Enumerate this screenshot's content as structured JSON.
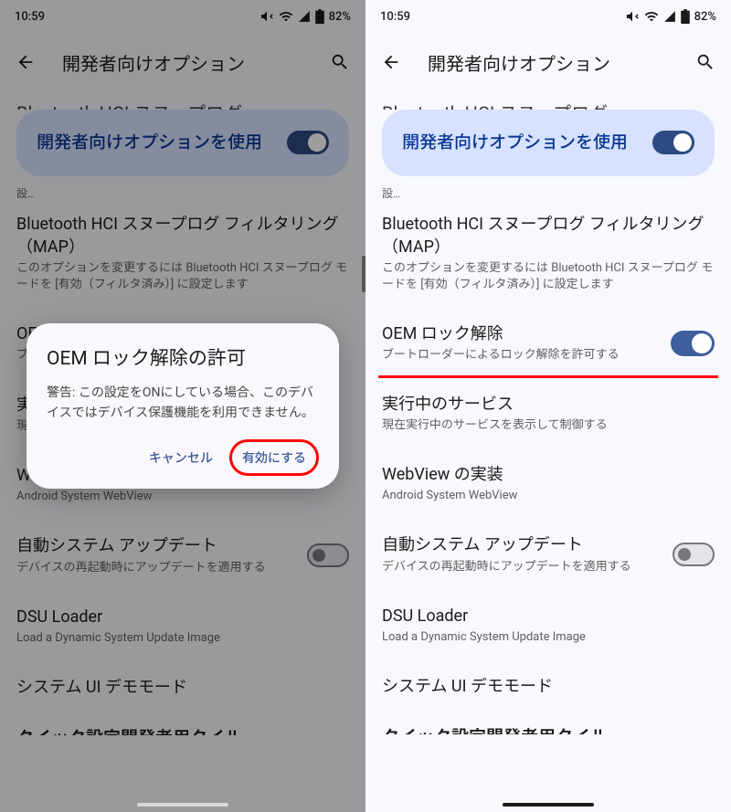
{
  "status": {
    "time": "10:59",
    "battery": "82%"
  },
  "header": {
    "title": "開発者向けオプション"
  },
  "partial_top": "Bluetooth HCI スヌープログ",
  "hero": {
    "text": "開発者向けオプションを使用"
  },
  "tiny_sub": "設…",
  "bt_filter": {
    "title": "Bluetooth HCI スヌープログ フィルタリング（MAP）",
    "sub": "このオプションを変更するには Bluetooth HCI スヌープログ モードを [有効（フィルタ済み）] に設定します"
  },
  "oem": {
    "title": "OEM ロック解除",
    "sub": "ブートローダーによるロック解除を許可する"
  },
  "running": {
    "title": "実行中のサービス",
    "sub": "現在実行中のサービスを表示して制御する"
  },
  "webview": {
    "title": "WebView の実装",
    "sub": "Android System WebView"
  },
  "autoupdate": {
    "title": "自動システム アップデート",
    "sub": "デバイスの再起動時にアップデートを適用する"
  },
  "dsu": {
    "title": "DSU Loader",
    "sub": "Load a Dynamic System Update Image"
  },
  "demo": {
    "title": "システム UI デモモード"
  },
  "bottom_cut": "クイック設定開発者用タイル",
  "dialog": {
    "title": "OEM ロック解除の許可",
    "msg": "警告: この設定をONにしている場合、このデバイスではデバイス保護機能を利用できません。",
    "cancel": "キャンセル",
    "enable": "有効にする"
  }
}
